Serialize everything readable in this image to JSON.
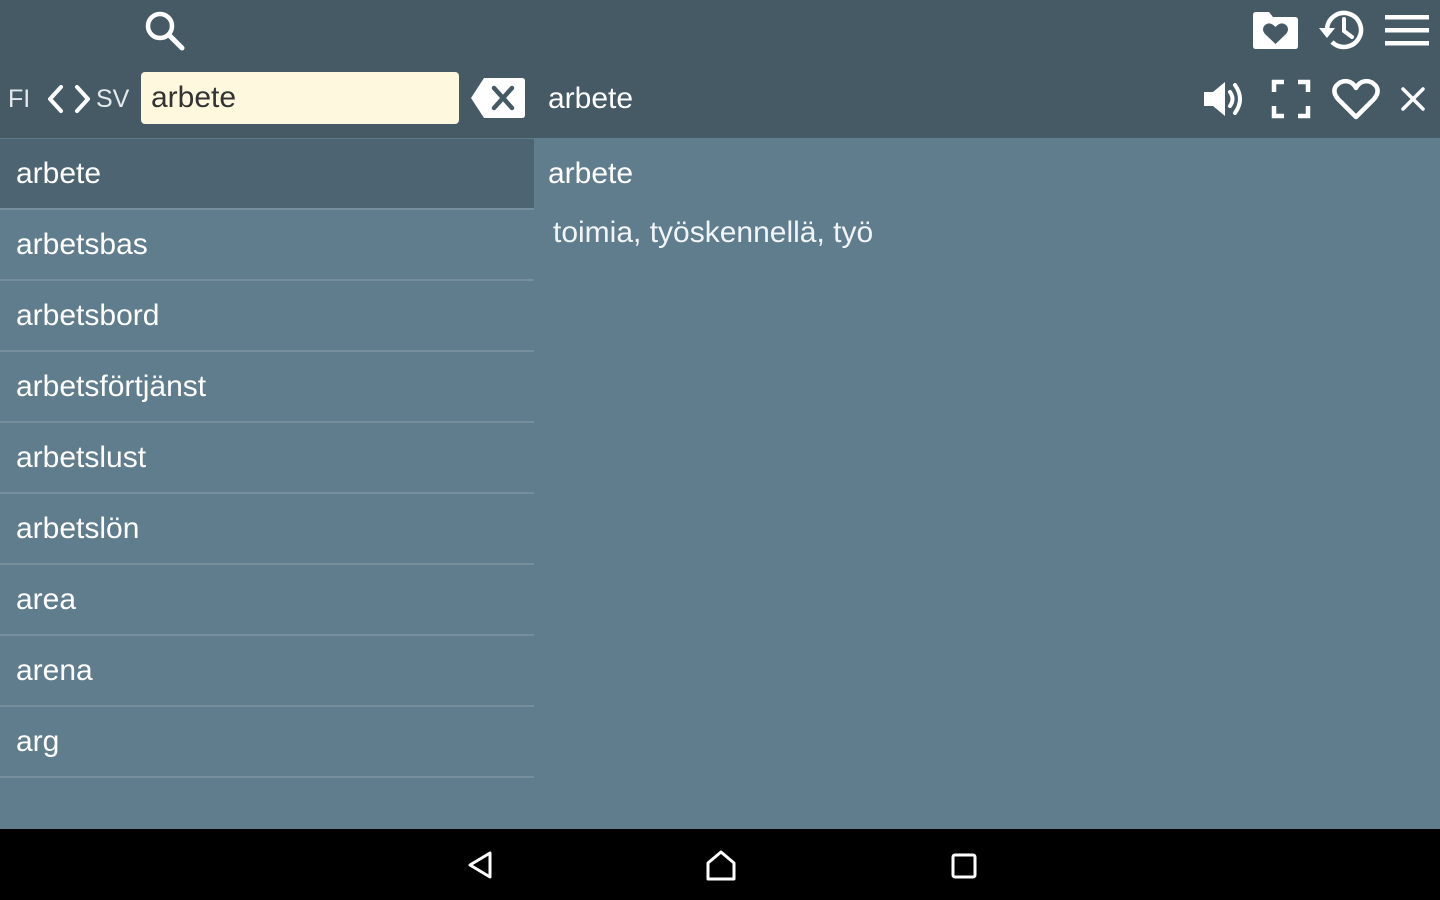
{
  "toolbar": {
    "icons": [
      "search-icon",
      "favorites-folder-icon",
      "history-icon",
      "menu-icon"
    ]
  },
  "language_switch": {
    "source": "FI",
    "target": "SV",
    "icon": "swap-arrows-icon"
  },
  "search": {
    "value": "arbete",
    "clear_icon": "backspace-clear-icon"
  },
  "detail_header": {
    "title": "arbete",
    "icons": [
      "speaker-icon",
      "fullscreen-icon",
      "heart-icon",
      "close-icon"
    ]
  },
  "word_list": {
    "selected_index": 0,
    "items": [
      "arbete",
      "arbetsbas",
      "arbetsbord",
      "arbetsförtjänst",
      "arbetslust",
      "arbetslön",
      "area",
      "arena",
      "arg"
    ]
  },
  "detail": {
    "word": "arbete",
    "translation": "toimia, työskennellä, työ"
  },
  "navigation_bar": {
    "icons": [
      "back-icon",
      "home-icon",
      "recents-icon"
    ]
  },
  "colors": {
    "topbar": "#455a64",
    "background": "#607d8e",
    "selected_row": "#4d6572",
    "search_field": "#fdf8de"
  }
}
